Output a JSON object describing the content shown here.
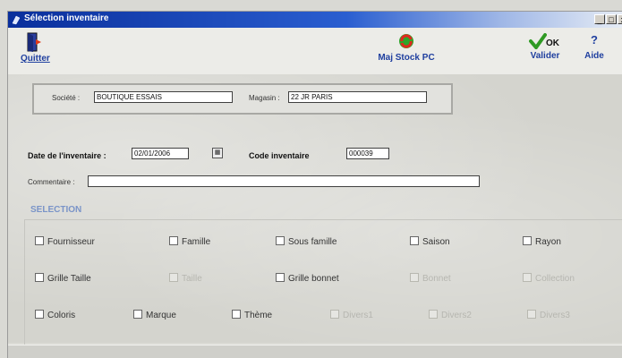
{
  "window": {
    "title": "Sélection inventaire"
  },
  "toolbar": {
    "quit_label": "Quitter",
    "maj_label": "Maj Stock PC",
    "ok_text": "OK",
    "validate_label": "Valider",
    "help_symbol": "?",
    "help_label": "Aide"
  },
  "header": {
    "societe_label": "Société :",
    "societe_value": "BOUTIQUE ESSAIS",
    "magasin_label": "Magasin :",
    "magasin_value": "22 JR PARIS"
  },
  "form": {
    "date_label": "Date de l'inventaire :",
    "date_value": "02/01/2006",
    "code_label": "Code inventaire",
    "code_value": "000039",
    "comment_label": "Commentaire :",
    "comment_value": ""
  },
  "selection": {
    "title": "SELECTION",
    "row1": [
      {
        "label": "Fournisseur",
        "enabled": true
      },
      {
        "label": "Famille",
        "enabled": true
      },
      {
        "label": "Sous famille",
        "enabled": true
      },
      {
        "label": "Saison",
        "enabled": true
      },
      {
        "label": "Rayon",
        "enabled": true
      }
    ],
    "row2": [
      {
        "label": "Grille Taille",
        "enabled": true
      },
      {
        "label": "Taille",
        "enabled": false
      },
      {
        "label": "Grille bonnet",
        "enabled": true
      },
      {
        "label": "Bonnet",
        "enabled": false
      },
      {
        "label": "Collection",
        "enabled": false
      }
    ],
    "row3": [
      {
        "label": "Coloris",
        "enabled": true
      },
      {
        "label": "Marque",
        "enabled": true
      },
      {
        "label": "Thème",
        "enabled": true
      },
      {
        "label": "Divers1",
        "enabled": false
      },
      {
        "label": "Divers2",
        "enabled": false
      },
      {
        "label": "Divers3",
        "enabled": false
      }
    ]
  },
  "icons": {
    "quit": "door-exit-icon",
    "maj": "refresh-icon",
    "validate": "checkmark-icon",
    "help": "question-icon"
  },
  "colors": {
    "titlebar": "#0a2f9c",
    "link_blue": "#1f3f9f",
    "section_title": "#7a94c8",
    "check_green": "#2f9a24"
  }
}
